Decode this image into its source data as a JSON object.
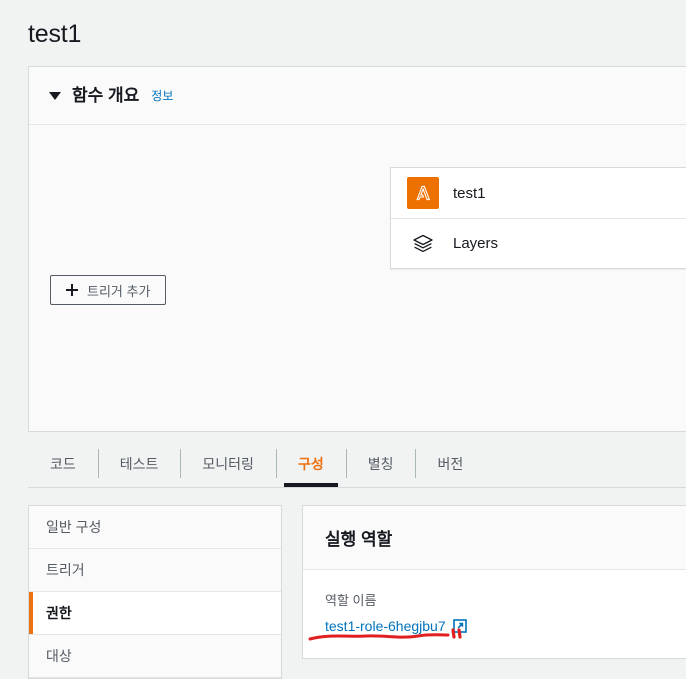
{
  "page": {
    "title": "test1"
  },
  "overview": {
    "title": "함수 개요",
    "info_link": "정보",
    "caret_icon": "caret-down-icon",
    "add_trigger": {
      "label": "트리거 추가",
      "icon": "plus-icon"
    },
    "resources": [
      {
        "label": "test1",
        "icon": "lambda-icon",
        "icon_color": "#ed7100"
      },
      {
        "label": "Layers",
        "icon": "layers-icon",
        "icon_color": "#16191f"
      }
    ]
  },
  "tabs": [
    {
      "label": "코드",
      "active": false
    },
    {
      "label": "테스트",
      "active": false
    },
    {
      "label": "모니터링",
      "active": false
    },
    {
      "label": "구성",
      "active": true
    },
    {
      "label": "별칭",
      "active": false
    },
    {
      "label": "버전",
      "active": false
    }
  ],
  "config_nav": [
    {
      "label": "일반 구성",
      "selected": false
    },
    {
      "label": "트리거",
      "selected": false
    },
    {
      "label": "권한",
      "selected": true
    },
    {
      "label": "대상",
      "selected": false
    }
  ],
  "execution_role": {
    "panel_title": "실행 역할",
    "field_label": "역할 이름",
    "role_name": "test1-role-6hegjbu7",
    "external_link_icon": "external-link-icon"
  },
  "annotation": {
    "type": "red-underline-scribble",
    "color": "#e02020"
  },
  "colors": {
    "accent_orange": "#ec7211",
    "link_blue": "#0073bb",
    "lambda_orange": "#ed7100",
    "page_background": "#f1f3f3",
    "card_background": "#fafafa",
    "text_primary": "#16191f",
    "text_secondary": "#545b64"
  }
}
